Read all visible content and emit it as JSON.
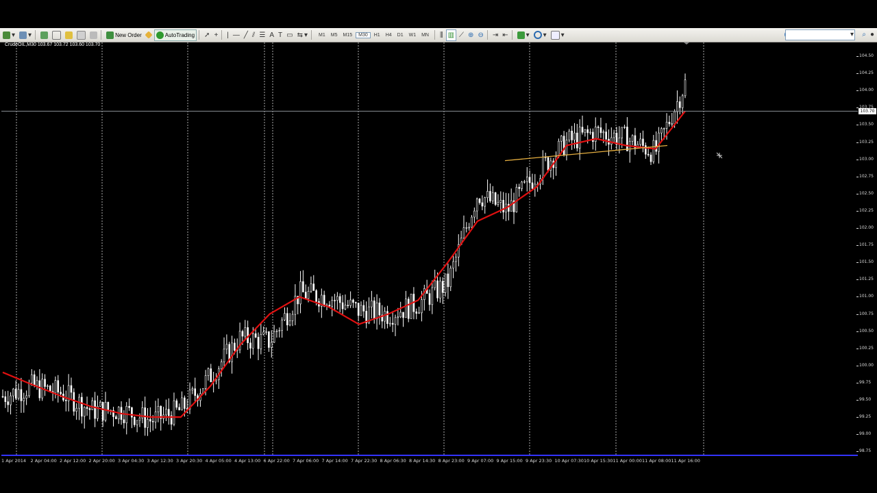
{
  "toolbar": {
    "new_order_label": "New Order",
    "autotrading_label": "AutoTrading",
    "timeframes": [
      "M1",
      "M5",
      "M15",
      "M30",
      "H1",
      "H4",
      "D1",
      "W1",
      "MN"
    ],
    "active_timeframe": "M30",
    "search_placeholder": ""
  },
  "chart": {
    "symbol_label": "CrudeOIL,M30  103.67 103.72 103.60 103.70",
    "current_price_label": "103.70",
    "price_ticks": [
      "104.50",
      "104.25",
      "104.00",
      "103.75",
      "103.50",
      "103.25",
      "103.00",
      "102.75",
      "102.50",
      "102.25",
      "102.00",
      "101.75",
      "101.50",
      "101.25",
      "101.00",
      "100.75",
      "100.50",
      "100.25",
      "100.00",
      "99.75",
      "99.50",
      "99.25",
      "99.00",
      "98.75"
    ],
    "time_labels": [
      "1 Apr 2014",
      "2 Apr 04:00",
      "2 Apr 12:00",
      "2 Apr 20:00",
      "3 Apr 04:30",
      "3 Apr 12:30",
      "3 Apr 20:30",
      "4 Apr 05:00",
      "4 Apr 13:00",
      "6 Apr 22:00",
      "7 Apr 06:00",
      "7 Apr 14:00",
      "7 Apr 22:30",
      "8 Apr 06:30",
      "8 Apr 14:30",
      "8 Apr 23:00",
      "9 Apr 07:00",
      "9 Apr 15:00",
      "9 Apr 23:30",
      "10 Apr 07:30",
      "10 Apr 15:30",
      "11 Apr 00:00",
      "11 Apr 08:00",
      "11 Apr 16:00"
    ],
    "colors": {
      "candles": "#ffffff",
      "moving_average": "#e01010",
      "trendline": "#e8b040",
      "grid": "#cccccc",
      "bottom_line": "#3333ff"
    }
  },
  "chart_data": {
    "type": "line",
    "title": "CrudeOIL,M30",
    "ylim": [
      98.75,
      104.55
    ],
    "x": [
      "1 Apr 2014",
      "2 Apr 04:00",
      "2 Apr 12:00",
      "2 Apr 20:00",
      "3 Apr 04:30",
      "3 Apr 12:30",
      "3 Apr 20:30",
      "4 Apr 05:00",
      "4 Apr 13:00",
      "6 Apr 22:00",
      "7 Apr 06:00",
      "7 Apr 14:00",
      "7 Apr 22:30",
      "8 Apr 06:30",
      "8 Apr 14:30",
      "8 Apr 23:00",
      "9 Apr 07:00",
      "9 Apr 15:00",
      "9 Apr 23:30",
      "10 Apr 07:30",
      "10 Apr 15:30",
      "11 Apr 00:00",
      "11 Apr 08:00",
      "11 Apr 16:00"
    ],
    "series": [
      {
        "values": [
          99.55,
          99.7,
          99.6,
          99.35,
          99.35,
          99.2,
          99.35,
          99.85,
          100.4,
          100.35,
          101.05,
          101.0,
          100.8,
          100.75,
          100.9,
          101.2,
          102.5,
          102.25,
          102.8,
          103.25,
          103.4,
          103.3,
          103.1,
          104.1
        ]
      },
      {
        "values": [
          99.9,
          99.72,
          99.55,
          99.4,
          99.3,
          99.25,
          99.25,
          99.7,
          100.3,
          100.75,
          101.0,
          100.85,
          100.6,
          100.75,
          100.95,
          101.5,
          102.1,
          102.3,
          102.6,
          103.2,
          103.3,
          103.2,
          103.15,
          103.7
        ]
      }
    ]
  }
}
